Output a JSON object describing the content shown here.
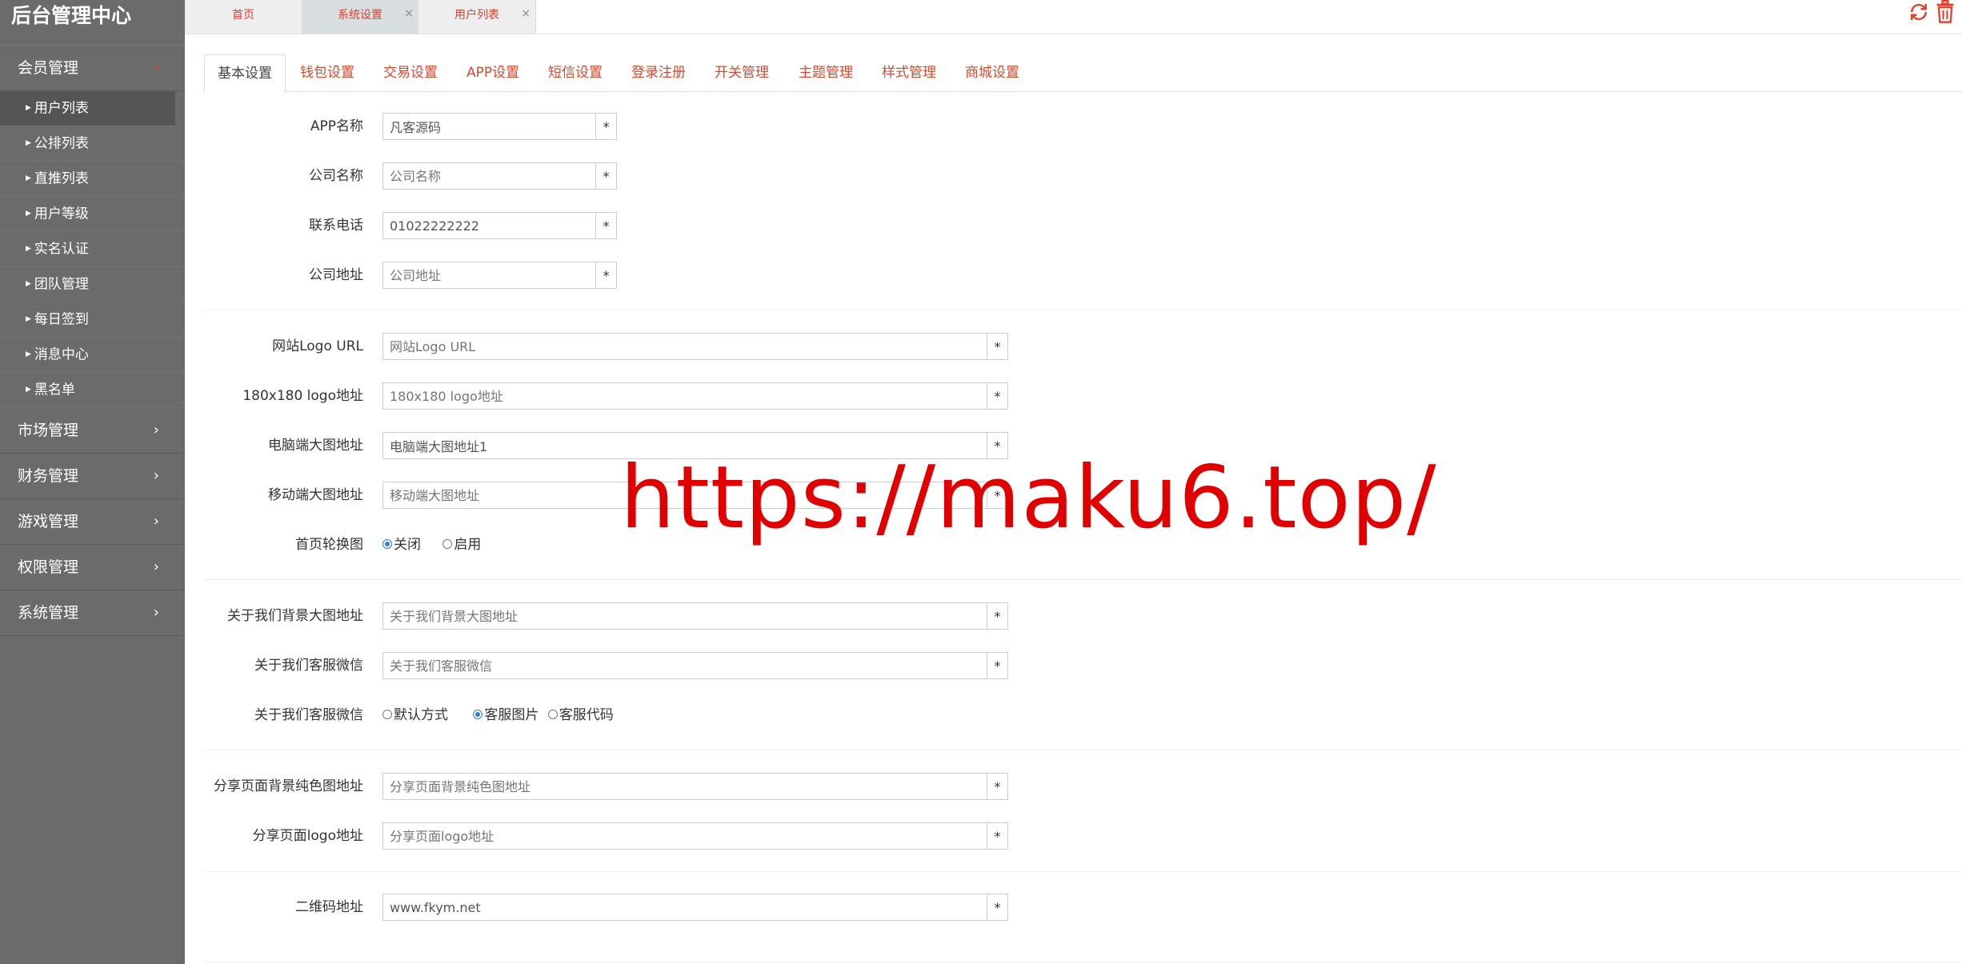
{
  "sidebar": {
    "brand": "后台管理中心",
    "open_group": {
      "label": "会员管理",
      "chevron": "chevron-right-icon",
      "chevron_color": "#e2402a"
    },
    "sub_items": [
      {
        "label": "用户列表",
        "active": true
      },
      {
        "label": "公排列表"
      },
      {
        "label": "直推列表"
      },
      {
        "label": "用户等级"
      },
      {
        "label": "实名认证"
      },
      {
        "label": "团队管理"
      },
      {
        "label": "每日签到"
      },
      {
        "label": "消息中心"
      },
      {
        "label": "黑名单"
      }
    ],
    "groups": [
      {
        "label": "市场管理"
      },
      {
        "label": "财务管理"
      },
      {
        "label": "游戏管理"
      },
      {
        "label": "权限管理"
      },
      {
        "label": "系统管理"
      }
    ]
  },
  "top_tabs": [
    {
      "label": "首页"
    },
    {
      "label": "系统设置",
      "close": "×"
    },
    {
      "label": "用户列表",
      "close": "×"
    }
  ],
  "top_icons": {
    "refresh": "refresh-icon",
    "trash": "trash-icon",
    "accent": "#e2402a"
  },
  "content_tabs": [
    "基本设置",
    "钱包设置",
    "交易设置",
    "APP设置",
    "短信设置",
    "登录注册",
    "开关管理",
    "主题管理",
    "样式管理",
    "商城设置"
  ],
  "form": {
    "app_name": {
      "label": "APP名称",
      "value": "凡客源码"
    },
    "company_name": {
      "label": "公司名称",
      "placeholder": "公司名称"
    },
    "phone": {
      "label": "联系电话",
      "value": "01022222222"
    },
    "company_addr": {
      "label": "公司地址",
      "placeholder": "公司地址"
    },
    "logo_url": {
      "label": "网站Logo URL",
      "placeholder": "网站Logo URL"
    },
    "logo180": {
      "label": "180x180 logo地址",
      "placeholder": "180x180 logo地址"
    },
    "pc_banner": {
      "label": "电脑端大图地址",
      "value": "电脑端大图地址1"
    },
    "mobile_banner": {
      "label": "移动端大图地址",
      "placeholder": "移动端大图地址"
    },
    "carousel": {
      "label": "首页轮换图",
      "options": [
        "关闭",
        "启用"
      ],
      "selected": "关闭"
    },
    "about_bg": {
      "label": "关于我们背景大图地址",
      "placeholder": "关于我们背景大图地址"
    },
    "about_wechat": {
      "label": "关于我们客服微信",
      "placeholder": "关于我们客服微信"
    },
    "about_wechat_mode": {
      "label": "关于我们客服微信",
      "options": [
        "默认方式",
        "客服图片",
        "客服代码"
      ],
      "selected": "客服图片"
    },
    "share_bg": {
      "label": "分享页面背景纯色图地址",
      "placeholder": "分享页面背景纯色图地址"
    },
    "share_logo": {
      "label": "分享页面logo地址",
      "placeholder": "分享页面logo地址"
    },
    "qrcode": {
      "label": "二维码地址",
      "value": "www.fkym.net"
    },
    "required_mark": "*"
  },
  "watermark": "https://maku6.top/"
}
